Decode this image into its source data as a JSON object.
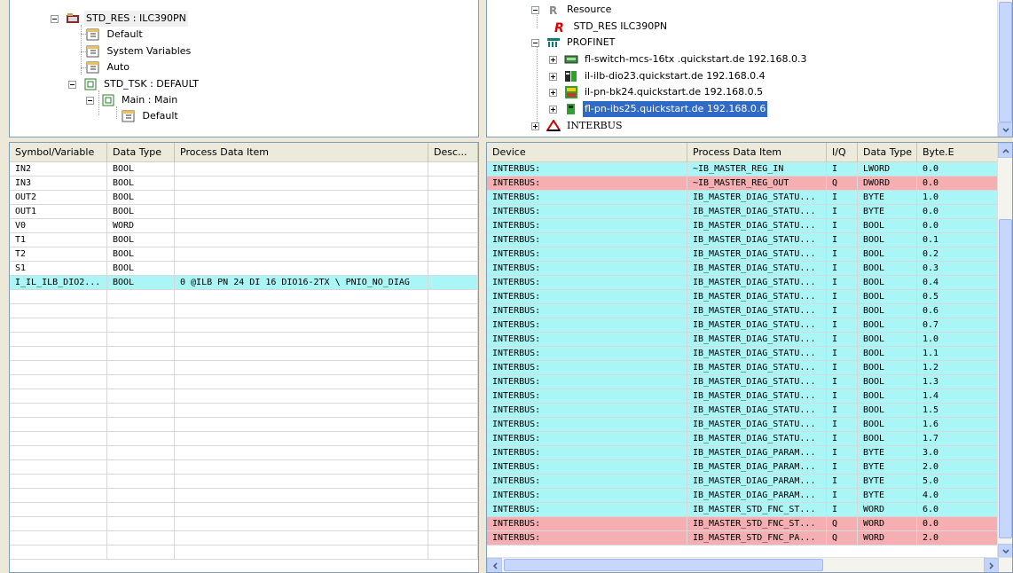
{
  "colors": {
    "row_input": "#aaf5f5",
    "row_output": "#f5aeb1",
    "selection": "#316ac5",
    "header_bg": "#ebeadb"
  },
  "left_tree": {
    "nodes": [
      {
        "label": "STD_RES : ILC390PN",
        "icon": "resource-folder-icon"
      },
      {
        "label": "Default",
        "icon": "variable-table-icon"
      },
      {
        "label": "System Variables",
        "icon": "variable-table-icon"
      },
      {
        "label": "Auto",
        "icon": "variable-table-icon"
      },
      {
        "label": "STD_TSK : DEFAULT",
        "icon": "task-icon"
      },
      {
        "label": "Main : Main",
        "icon": "program-icon"
      },
      {
        "label": "Default",
        "icon": "variable-table-icon"
      }
    ]
  },
  "right_tree": {
    "nodes": [
      {
        "label": "Resource",
        "icon": "resource-icon"
      },
      {
        "label": "STD_RES ILC390PN",
        "icon": "red-r-icon"
      },
      {
        "label": "PROFINET",
        "icon": "profinet-icon"
      },
      {
        "label": "fl-switch-mcs-16tx .quickstart.de 192.168.0.3",
        "icon": "switch-icon"
      },
      {
        "label": "il-ilb-dio23.quickstart.de 192.168.0.4",
        "icon": "io-module-icon"
      },
      {
        "label": "il-pn-bk24.quickstart.de 192.168.0.5",
        "icon": "bus-coupler-icon"
      },
      {
        "label": "fl-pn-ibs25.quickstart.de 192.168.0.6",
        "icon": "proxy-icon",
        "selected": true
      },
      {
        "label": "INTERBUS",
        "icon": "interbus-icon"
      }
    ]
  },
  "variables_grid": {
    "columns": [
      "Symbol/Variable",
      "Data Type",
      "Process Data Item",
      "Desc..."
    ],
    "rows": [
      [
        "IN2",
        "BOOL",
        ""
      ],
      [
        "IN3",
        "BOOL",
        ""
      ],
      [
        "OUT2",
        "BOOL",
        ""
      ],
      [
        "OUT1",
        "BOOL",
        ""
      ],
      [
        "V0",
        "WORD",
        ""
      ],
      [
        "T1",
        "BOOL",
        ""
      ],
      [
        "T2",
        "BOOL",
        ""
      ],
      [
        "S1",
        "BOOL",
        ""
      ],
      [
        "I_IL_ILB_DIO2...",
        "BOOL",
        "0 @ILB PN 24 DI 16 DIO16-2TX \\ PNIO_NO_DIAG"
      ]
    ]
  },
  "process_grid": {
    "columns": [
      "Device",
      "Process Data Item",
      "I/Q",
      "Data Type",
      "Byte.Bit"
    ],
    "header_last_visible": "Byte.E",
    "rows": [
      [
        "INTERBUS:",
        "~IB_MASTER_REG_IN",
        "I",
        "LWORD",
        "0.0"
      ],
      [
        "INTERBUS:",
        "~IB_MASTER_REG_OUT",
        "Q",
        "DWORD",
        "0.0"
      ],
      [
        "INTERBUS:",
        "IB_MASTER_DIAG_STATU...",
        "I",
        "BYTE",
        "1.0"
      ],
      [
        "INTERBUS:",
        "IB_MASTER_DIAG_STATU...",
        "I",
        "BYTE",
        "0.0"
      ],
      [
        "INTERBUS:",
        "IB_MASTER_DIAG_STATU...",
        "I",
        "BOOL",
        "0.0"
      ],
      [
        "INTERBUS:",
        "IB_MASTER_DIAG_STATU...",
        "I",
        "BOOL",
        "0.1"
      ],
      [
        "INTERBUS:",
        "IB_MASTER_DIAG_STATU...",
        "I",
        "BOOL",
        "0.2"
      ],
      [
        "INTERBUS:",
        "IB_MASTER_DIAG_STATU...",
        "I",
        "BOOL",
        "0.3"
      ],
      [
        "INTERBUS:",
        "IB_MASTER_DIAG_STATU...",
        "I",
        "BOOL",
        "0.4"
      ],
      [
        "INTERBUS:",
        "IB_MASTER_DIAG_STATU...",
        "I",
        "BOOL",
        "0.5"
      ],
      [
        "INTERBUS:",
        "IB_MASTER_DIAG_STATU...",
        "I",
        "BOOL",
        "0.6"
      ],
      [
        "INTERBUS:",
        "IB_MASTER_DIAG_STATU...",
        "I",
        "BOOL",
        "0.7"
      ],
      [
        "INTERBUS:",
        "IB_MASTER_DIAG_STATU...",
        "I",
        "BOOL",
        "1.0"
      ],
      [
        "INTERBUS:",
        "IB_MASTER_DIAG_STATU...",
        "I",
        "BOOL",
        "1.1"
      ],
      [
        "INTERBUS:",
        "IB_MASTER_DIAG_STATU...",
        "I",
        "BOOL",
        "1.2"
      ],
      [
        "INTERBUS:",
        "IB_MASTER_DIAG_STATU...",
        "I",
        "BOOL",
        "1.3"
      ],
      [
        "INTERBUS:",
        "IB_MASTER_DIAG_STATU...",
        "I",
        "BOOL",
        "1.4"
      ],
      [
        "INTERBUS:",
        "IB_MASTER_DIAG_STATU...",
        "I",
        "BOOL",
        "1.5"
      ],
      [
        "INTERBUS:",
        "IB_MASTER_DIAG_STATU...",
        "I",
        "BOOL",
        "1.6"
      ],
      [
        "INTERBUS:",
        "IB_MASTER_DIAG_STATU...",
        "I",
        "BOOL",
        "1.7"
      ],
      [
        "INTERBUS:",
        "IB_MASTER_DIAG_PARAM...",
        "I",
        "BYTE",
        "3.0"
      ],
      [
        "INTERBUS:",
        "IB_MASTER_DIAG_PARAM...",
        "I",
        "BYTE",
        "2.0"
      ],
      [
        "INTERBUS:",
        "IB_MASTER_DIAG_PARAM...",
        "I",
        "BYTE",
        "5.0"
      ],
      [
        "INTERBUS:",
        "IB_MASTER_DIAG_PARAM...",
        "I",
        "BYTE",
        "4.0"
      ],
      [
        "INTERBUS:",
        "IB_MASTER_STD_FNC_ST...",
        "I",
        "WORD",
        "6.0"
      ],
      [
        "INTERBUS:",
        "IB_MASTER_STD_FNC_ST...",
        "Q",
        "WORD",
        "0.0"
      ],
      [
        "INTERBUS:",
        "IB_MASTER_STD_FNC_PA...",
        "Q",
        "WORD",
        "2.0"
      ]
    ]
  }
}
